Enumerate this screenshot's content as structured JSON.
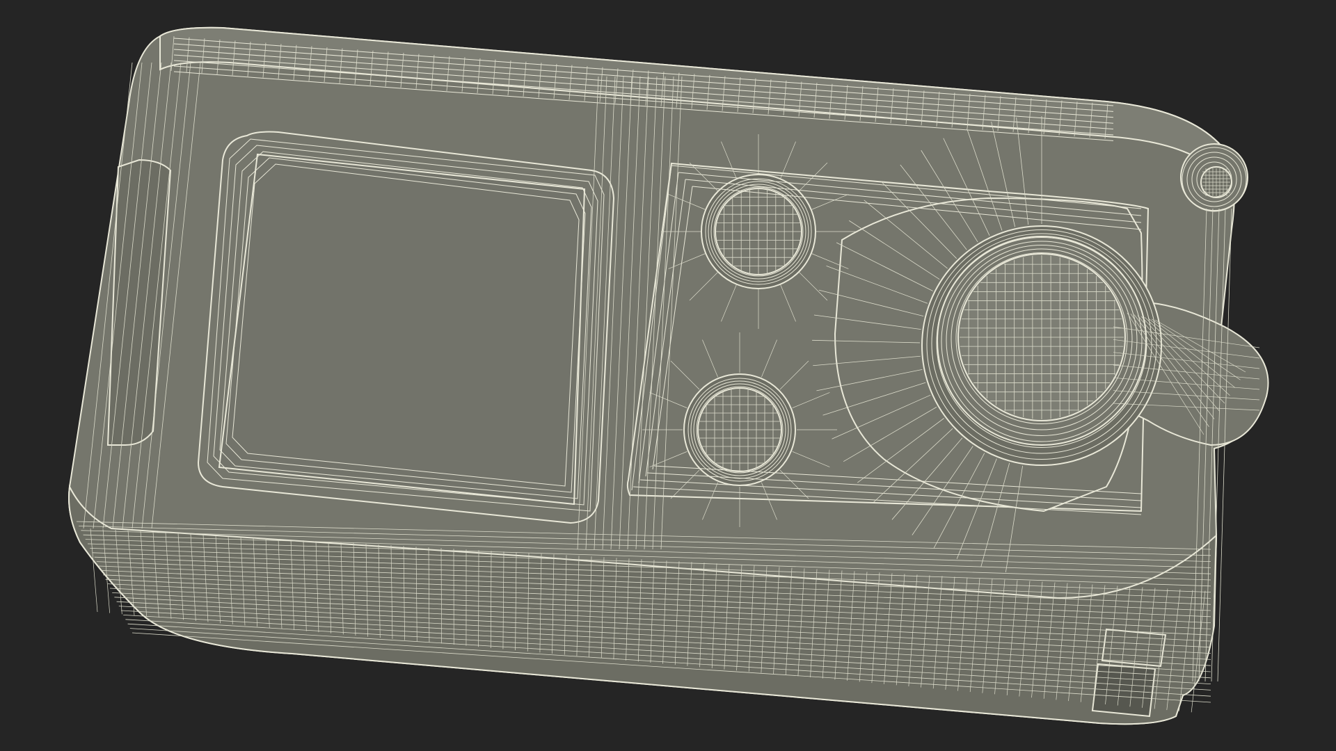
{
  "scene": {
    "subject": "wireframe-device-render",
    "colors": {
      "background": "#252525",
      "body_fill": "#75766c",
      "body_fill_dark": "#6c6d63",
      "body_fill_light": "#7d7e74",
      "screen_fill": "#72736a",
      "wire": "#e9e8d8",
      "wire_dense": "#dcdccb",
      "shadow": "#56574f"
    },
    "icons": {
      "viewer": "mesh-wireframe-icon"
    }
  }
}
